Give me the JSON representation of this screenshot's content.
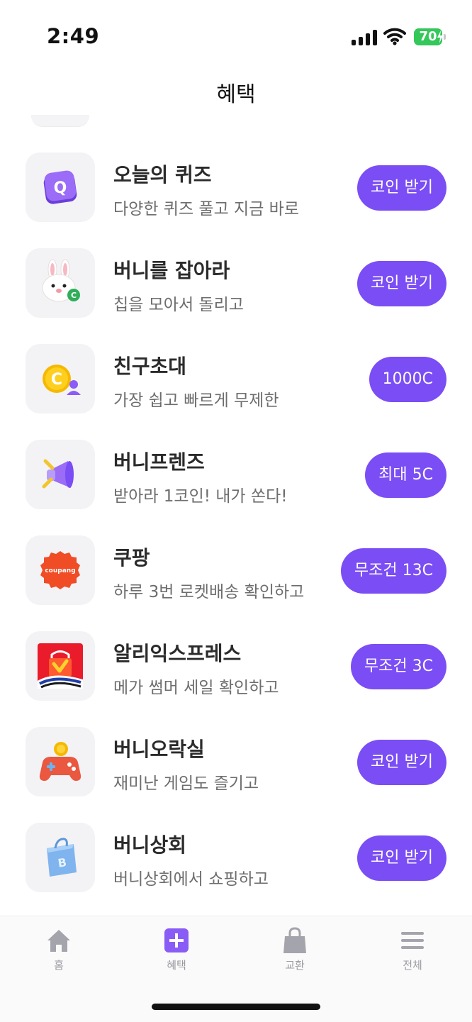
{
  "status": {
    "time": "2:49",
    "battery": "70"
  },
  "header": {
    "title": "혜택"
  },
  "benefits": [
    {
      "title": "오늘의 퀴즈",
      "subtitle": "다양한 퀴즈 풀고 지금 바로",
      "button": "코인 받기",
      "icon": "quiz-icon"
    },
    {
      "title": "버니를 잡아라",
      "subtitle": "칩을 모아서 돌리고",
      "button": "코인 받기",
      "icon": "bunny-icon"
    },
    {
      "title": "친구초대",
      "subtitle": "가장 쉽고 빠르게 무제한",
      "button": "1000C",
      "icon": "coin-user-icon"
    },
    {
      "title": "버니프렌즈",
      "subtitle": "받아라 1코인! 내가 쏜다!",
      "button": "최대 5C",
      "icon": "megaphone-icon"
    },
    {
      "title": "쿠팡",
      "subtitle": "하루 3번 로켓배송 확인하고",
      "button": "무조건 13C",
      "icon": "coupang-logo",
      "logo_text": "coupang"
    },
    {
      "title": "알리익스프레스",
      "subtitle": "메가 썸머 세일 확인하고",
      "button": "무조건 3C",
      "icon": "aliexpress-logo"
    },
    {
      "title": "버니오락실",
      "subtitle": "재미난 게임도 즐기고",
      "button": "코인 받기",
      "icon": "gamepad-icon"
    },
    {
      "title": "버니상회",
      "subtitle": "버니상회에서 쇼핑하고",
      "button": "코인 받기",
      "icon": "shopping-bag-icon"
    }
  ],
  "tabs": [
    {
      "label": "홈",
      "icon": "home-icon"
    },
    {
      "label": "혜택",
      "icon": "plus-icon",
      "active": true
    },
    {
      "label": "교환",
      "icon": "bag-icon"
    },
    {
      "label": "전체",
      "icon": "menu-icon"
    }
  ],
  "colors": {
    "accent": "#7b4df5",
    "thumb_bg": "#f3f3f6",
    "battery": "#34c759"
  }
}
